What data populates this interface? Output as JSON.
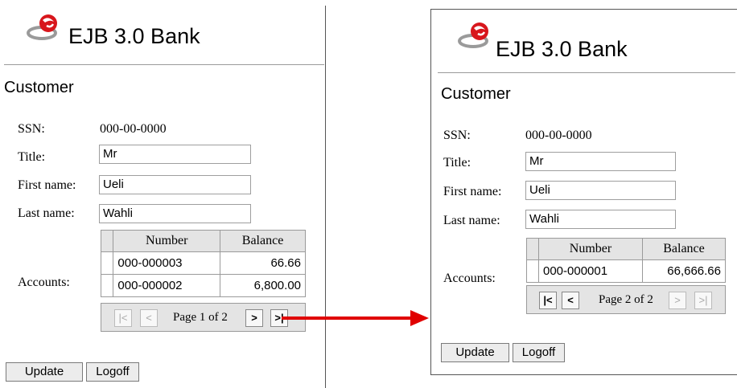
{
  "app_title": "EJB 3.0 Bank",
  "heading": "Customer",
  "labels": {
    "ssn": "SSN:",
    "title": "Title:",
    "first_name": "First name:",
    "last_name": "Last name:",
    "accounts": "Accounts:"
  },
  "customer": {
    "ssn": "000-00-0000",
    "title": "Mr",
    "first_name": "Ueli",
    "last_name": "Wahli"
  },
  "table_headers": {
    "number": "Number",
    "balance": "Balance"
  },
  "page1": {
    "accounts": [
      {
        "number": "000-000003",
        "balance": "66.66"
      },
      {
        "number": "000-000002",
        "balance": "6,800.00"
      }
    ],
    "pager_text": "Page 1 of 2"
  },
  "page2": {
    "accounts": [
      {
        "number": "000-000001",
        "balance": "66,666.66"
      }
    ],
    "pager_text": "Page 2 of 2"
  },
  "buttons": {
    "update": "Update",
    "logoff": "Logoff"
  },
  "pager_icons": {
    "first": "|<",
    "prev": "<",
    "next": ">",
    "last": ">|"
  },
  "colors": {
    "arrow": "#e00000",
    "logo_red": "#d8161c"
  }
}
